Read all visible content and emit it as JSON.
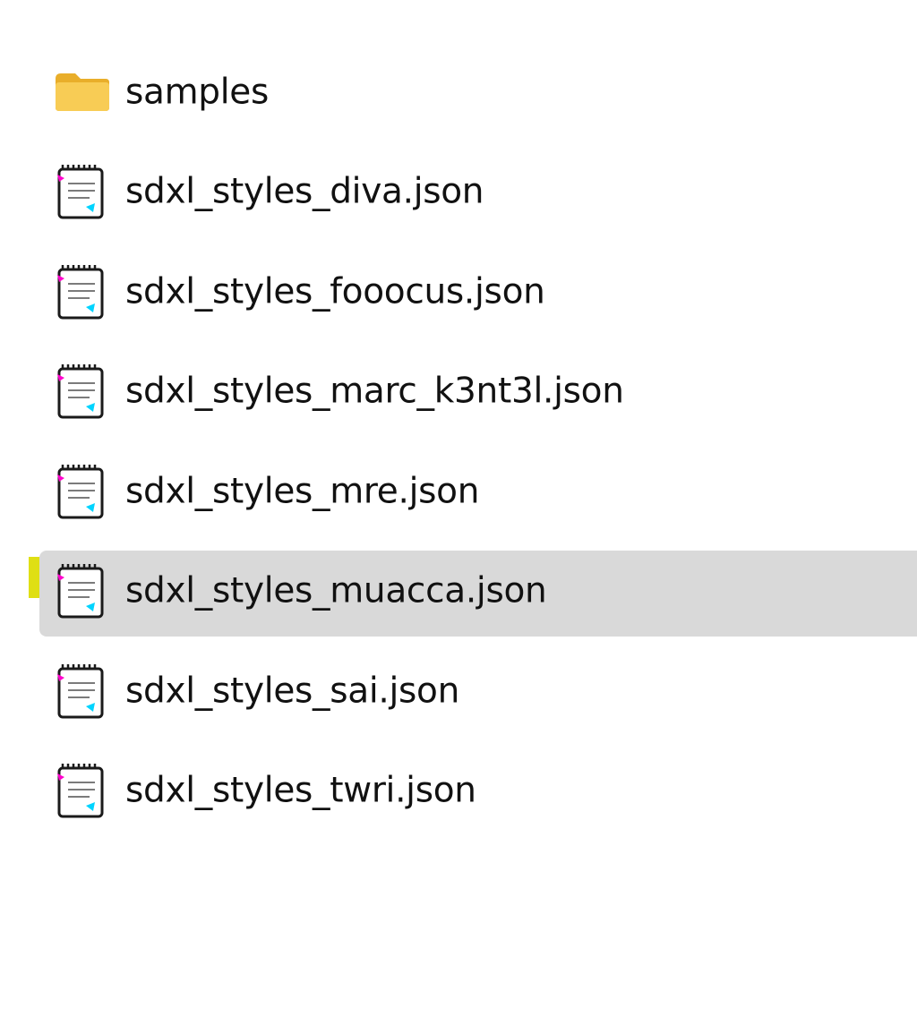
{
  "explorer": {
    "items": [
      {
        "name": "samples",
        "type": "folder",
        "icon": "folder-icon",
        "selected": false
      },
      {
        "name": "sdxl_styles_diva.json",
        "type": "file",
        "icon": "json-file-icon",
        "selected": false
      },
      {
        "name": "sdxl_styles_fooocus.json",
        "type": "file",
        "icon": "json-file-icon",
        "selected": false
      },
      {
        "name": "sdxl_styles_marc_k3nt3l.json",
        "type": "file",
        "icon": "json-file-icon",
        "selected": false
      },
      {
        "name": "sdxl_styles_mre.json",
        "type": "file",
        "icon": "json-file-icon",
        "selected": false
      },
      {
        "name": "sdxl_styles_muacca.json",
        "type": "file",
        "icon": "json-file-icon",
        "selected": true
      },
      {
        "name": "sdxl_styles_sai.json",
        "type": "file",
        "icon": "json-file-icon",
        "selected": false
      },
      {
        "name": "sdxl_styles_twri.json",
        "type": "file",
        "icon": "json-file-icon",
        "selected": false
      }
    ]
  },
  "colors": {
    "selection": "#d9d9d9",
    "highlight_marker": "#dcdc00",
    "folder": "#f6c544"
  }
}
